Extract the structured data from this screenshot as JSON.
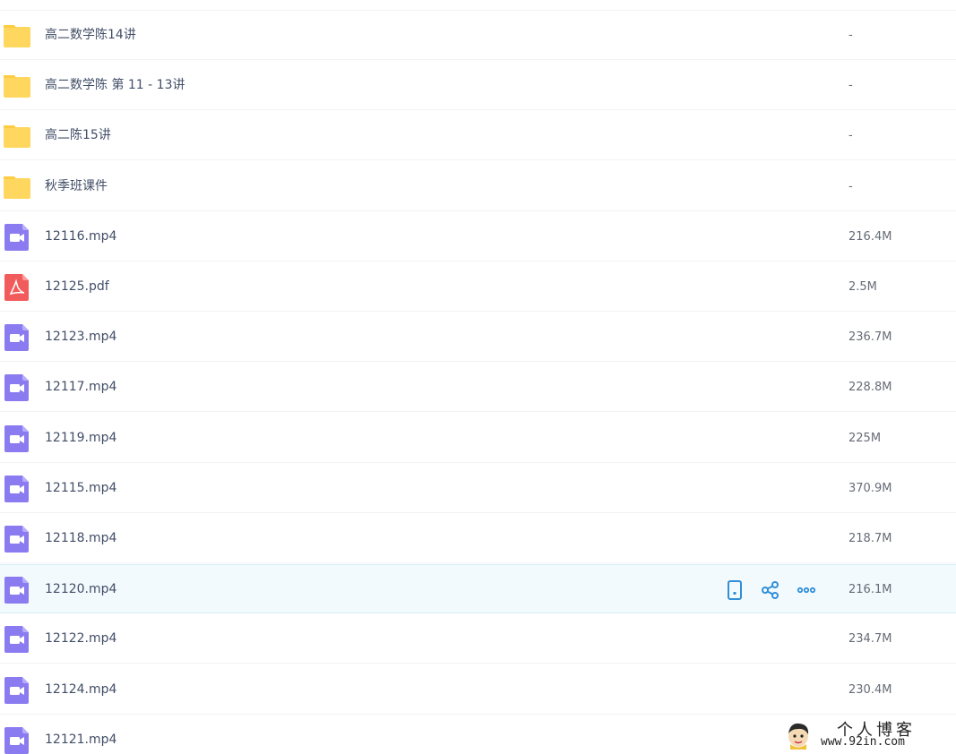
{
  "files": [
    {
      "name": "高二数学陈14讲",
      "size": "-",
      "type": "folder"
    },
    {
      "name": "高二数学陈 第 11 - 13讲",
      "size": "-",
      "type": "folder"
    },
    {
      "name": "高二陈15讲",
      "size": "-",
      "type": "folder"
    },
    {
      "name": "秋季班课件",
      "size": "-",
      "type": "folder"
    },
    {
      "name": "12116.mp4",
      "size": "216.4M",
      "type": "video"
    },
    {
      "name": "12125.pdf",
      "size": "2.5M",
      "type": "pdf"
    },
    {
      "name": "12123.mp4",
      "size": "236.7M",
      "type": "video"
    },
    {
      "name": "12117.mp4",
      "size": "228.8M",
      "type": "video"
    },
    {
      "name": "12119.mp4",
      "size": "225M",
      "type": "video"
    },
    {
      "name": "12115.mp4",
      "size": "370.9M",
      "type": "video"
    },
    {
      "name": "12118.mp4",
      "size": "218.7M",
      "type": "video"
    },
    {
      "name": "12120.mp4",
      "size": "216.1M",
      "type": "video",
      "hovered": true
    },
    {
      "name": "12122.mp4",
      "size": "234.7M",
      "type": "video"
    },
    {
      "name": "12124.mp4",
      "size": "230.4M",
      "type": "video"
    },
    {
      "name": "12121.mp4",
      "size": "",
      "type": "video"
    }
  ],
  "hover_actions": [
    {
      "icon": "phone-icon"
    },
    {
      "icon": "share-icon"
    },
    {
      "icon": "more-icon"
    }
  ],
  "icons": {
    "folder": "folder-icon",
    "video": "video-file-icon",
    "pdf": "pdf-file-icon"
  },
  "colors": {
    "folder": "#ffd75e",
    "video": "#8a7cf0",
    "pdf": "#f25b5b",
    "action": "#2f8fd8",
    "hover_bg": "#f3fafe"
  },
  "watermark": {
    "title": "个人博客",
    "url": "www.92in.com"
  }
}
